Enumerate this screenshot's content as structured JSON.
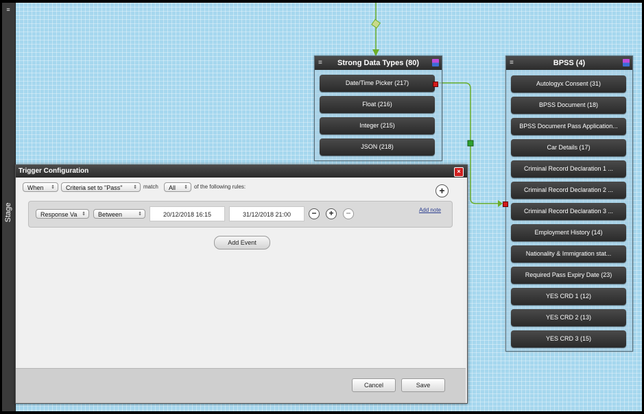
{
  "stage": {
    "label": "Stage",
    "menu_icon": "≡"
  },
  "strong_data_types": {
    "title": "Strong Data Types (80)",
    "items": [
      "Date/Time Picker (217)",
      "Float (216)",
      "Integer (215)",
      "JSON (218)"
    ]
  },
  "bpss": {
    "title": "BPSS (4)",
    "items": [
      "Autologyx Consent (31)",
      "BPSS Document (18)",
      "BPSS Document Pass Application...",
      "Car Details (17)",
      "Criminal Record Declaration 1 ...",
      "Criminal Record Declaration 2 ...",
      "Criminal Record Declaration 3 ...",
      "Employment History (14)",
      "Nationality & Immigration stat...",
      "Required Pass Expiry Date (23)",
      "YES CRD 1 (12)",
      "YES CRD 2 (13)",
      "YES CRD 3 (15)"
    ]
  },
  "dialog": {
    "title": "Trigger Configuration",
    "close_symbol": "×",
    "when_select": "When",
    "criteria_select": "Criteria set to \"Pass\"",
    "match_label": "match",
    "match_select": "All",
    "rules_text": "of the following rules:",
    "add_rule_symbol": "+",
    "rule": {
      "field_select": "Response Va",
      "operator_select": "Between",
      "date_from": "20/12/2018 16:15",
      "date_to": "31/12/2018 21:00",
      "add_note": "Add note"
    },
    "add_event": "Add Event",
    "cancel": "Cancel",
    "save": "Save"
  },
  "colors": {
    "canvas": "#a6d7ee",
    "connector": "#6cae2a",
    "node_dark": "#2f2f2f",
    "close_red": "#d01f1f"
  }
}
